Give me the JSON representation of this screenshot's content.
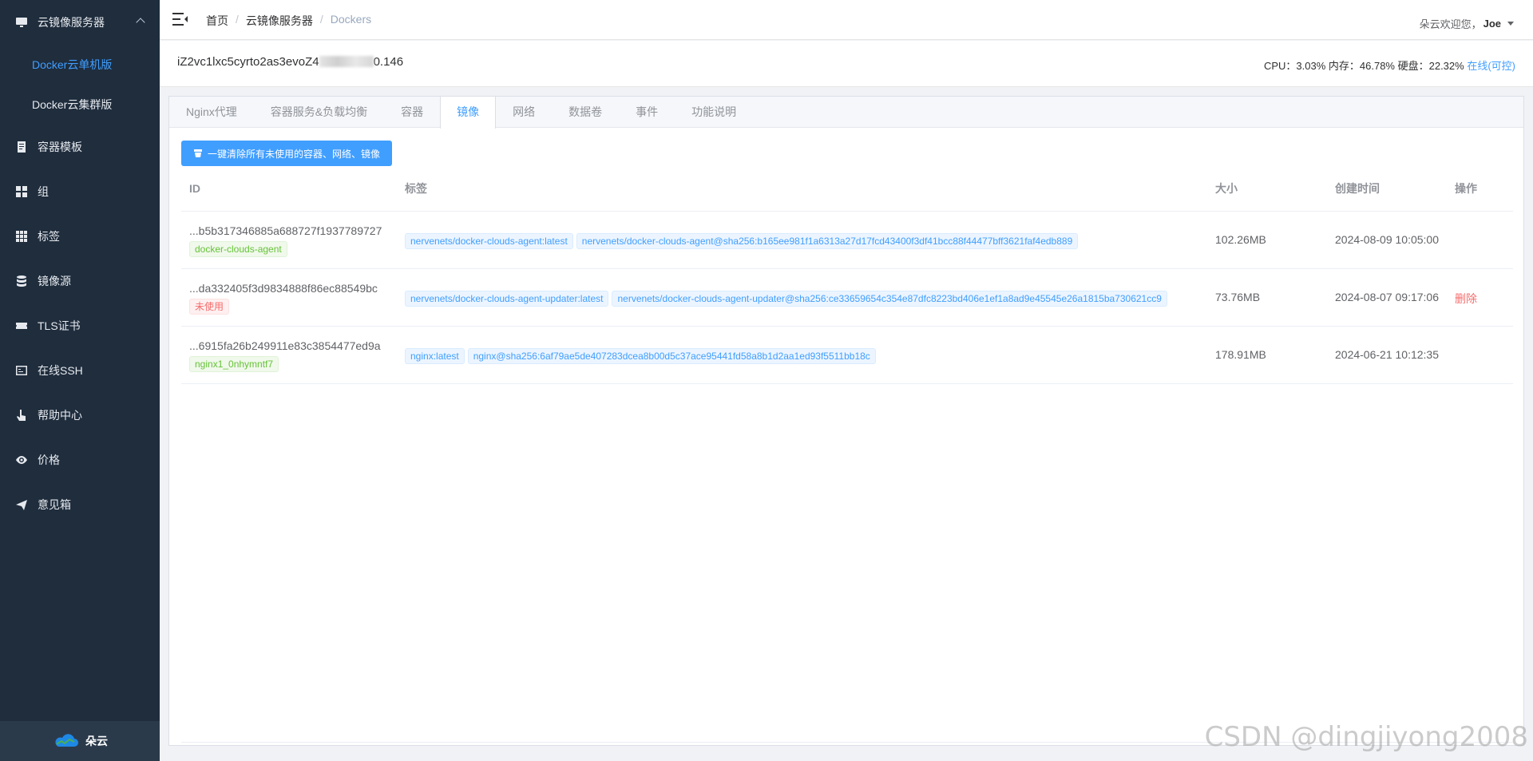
{
  "sidebar": {
    "group_label": "云镜像服务器",
    "sub_items": [
      {
        "label": "Docker云单机版"
      },
      {
        "label": "Docker云集群版"
      }
    ],
    "items": [
      {
        "label": "容器模板",
        "icon": "document-icon"
      },
      {
        "label": "组",
        "icon": "grid-icon"
      },
      {
        "label": "标签",
        "icon": "apps-icon"
      },
      {
        "label": "镜像源",
        "icon": "database-icon"
      },
      {
        "label": "TLS证书",
        "icon": "ticket-icon"
      },
      {
        "label": "在线SSH",
        "icon": "terminal-icon"
      },
      {
        "label": "帮助中心",
        "icon": "pointer-icon"
      },
      {
        "label": "价格",
        "icon": "eye-icon"
      },
      {
        "label": "意见箱",
        "icon": "send-icon"
      }
    ],
    "footer": "朵云"
  },
  "navbar": {
    "breadcrumb": [
      "首页",
      "云镜像服务器",
      "Dockers"
    ],
    "greeting": "朵云欢迎您，",
    "username": "Joe"
  },
  "host": {
    "name_prefix": "iZ2vc1lxc5cyrto2as3evoZ4",
    "name_suffix": "0.146",
    "stats": "CPU：3.03% 内存：46.78% 硬盘：22.32%",
    "status": "在线(可控)"
  },
  "tabs": [
    {
      "label": "Nginx代理"
    },
    {
      "label": "容器服务&负载均衡"
    },
    {
      "label": "容器"
    },
    {
      "label": "镜像"
    },
    {
      "label": "网络"
    },
    {
      "label": "数据卷"
    },
    {
      "label": "事件"
    },
    {
      "label": "功能说明"
    }
  ],
  "prune_button": "一键清除所有未使用的容器、网络、镜像",
  "table": {
    "headers": {
      "id": "ID",
      "tags": "标签",
      "size": "大小",
      "created": "创建时间",
      "action": "操作"
    },
    "rows": [
      {
        "id": "...b5b317346885a688727f1937789727",
        "container": "docker-clouds-agent",
        "tags": [
          "nervenets/docker-clouds-agent:latest",
          "nervenets/docker-clouds-agent@sha256:b165ee981f1a6313a27d17fcd43400f3df41bcc88f44477bff3621faf4edb889"
        ],
        "size": "102.26MB",
        "created": "2024-08-09 10:05:00",
        "action": ""
      },
      {
        "id": "...da332405f3d9834888f86ec88549bc",
        "container": "未使用",
        "tags": [
          "nervenets/docker-clouds-agent-updater:latest",
          "nervenets/docker-clouds-agent-updater@sha256:ce33659654c354e87dfc8223bd406e1ef1a8ad9e45545e26a1815ba730621cc9"
        ],
        "size": "73.76MB",
        "created": "2024-08-07 09:17:06",
        "action": "删除"
      },
      {
        "id": "...6915fa26b249911e83c3854477ed9a",
        "container": "nginx1_0nhymntf7",
        "tags": [
          "nginx:latest",
          "nginx@sha256:6af79ae5de407283dcea8b00d5c37ace95441fd58a8b1d2aa1ed93f5511bb18c"
        ],
        "size": "178.91MB",
        "created": "2024-06-21 10:12:35",
        "action": ""
      }
    ]
  },
  "watermark": "CSDN @dingjiyong2008",
  "colors": {
    "sidebar": "#1f2d3d",
    "accent": "#409eff",
    "danger": "#f56c6c",
    "success": "#67c23a"
  }
}
